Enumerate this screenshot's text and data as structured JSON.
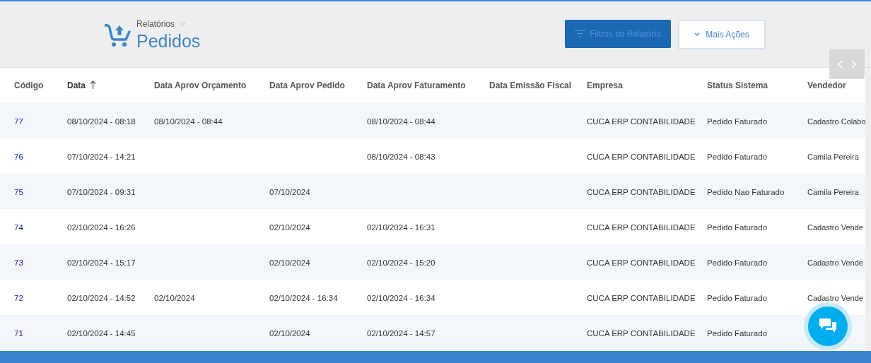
{
  "breadcrumb": {
    "parent": "Relatórios",
    "separator": ">",
    "title": "Pedidos"
  },
  "actions": [
    {
      "kind": "primary",
      "label": "Filtros do Relatório",
      "disabled": true
    },
    {
      "kind": "dropdown",
      "label": "Mais Ações",
      "disabled": false
    }
  ],
  "table": {
    "columns": [
      {
        "label": "Código",
        "sorted": false
      },
      {
        "label": "Data",
        "sorted": true
      },
      {
        "label": "Data Aprov Orçamento",
        "sorted": false
      },
      {
        "label": "Data Aprov Pedido",
        "sorted": false
      },
      {
        "label": "Data Aprov Faturamento",
        "sorted": false
      },
      {
        "label": "Data Emissão Fiscal",
        "sorted": false
      },
      {
        "label": "Empresa",
        "sorted": false
      },
      {
        "label": "Status Sistema",
        "sorted": false
      },
      {
        "label": "Vendedor",
        "sorted": false
      }
    ],
    "rows": [
      [
        "77",
        "08/10/2024 - 08:18",
        "08/10/2024 - 08:44",
        "",
        "08/10/2024 - 08:44",
        "",
        "CUCA ERP CONTABILIDADE",
        "Pedido Faturado",
        "Cadastro Colabo"
      ],
      [
        "76",
        "07/10/2024 - 14:21",
        "",
        "",
        "08/10/2024 - 08:43",
        "",
        "CUCA ERP CONTABILIDADE",
        "Pedido Faturado",
        "Camila Pereira"
      ],
      [
        "75",
        "07/10/2024 - 09:31",
        "",
        "07/10/2024",
        "",
        "",
        "CUCA ERP CONTABILIDADE",
        "Pedido Nao Faturado",
        "Camila Pereira"
      ],
      [
        "74",
        "02/10/2024 - 16:26",
        "",
        "02/10/2024",
        "02/10/2024 - 16:31",
        "",
        "CUCA ERP CONTABILIDADE",
        "Pedido Faturado",
        "Cadastro Vende"
      ],
      [
        "73",
        "02/10/2024 - 15:17",
        "",
        "02/10/2024",
        "02/10/2024 - 15:20",
        "",
        "CUCA ERP CONTABILIDADE",
        "Pedido Faturado",
        "Cadastro Vende"
      ],
      [
        "72",
        "02/10/2024 - 14:52",
        "02/10/2024",
        "02/10/2024 - 16:34",
        "02/10/2024 - 16:34",
        "",
        "CUCA ERP CONTABILIDADE",
        "Pedido Faturado",
        "Cadastro Vende"
      ],
      [
        "71",
        "02/10/2024 - 14:45",
        "",
        "02/10/2024",
        "02/10/2024 - 14:57",
        "",
        "CUCA ERP CONTABILIDADE",
        "Pedido Faturado",
        ""
      ]
    ]
  }
}
